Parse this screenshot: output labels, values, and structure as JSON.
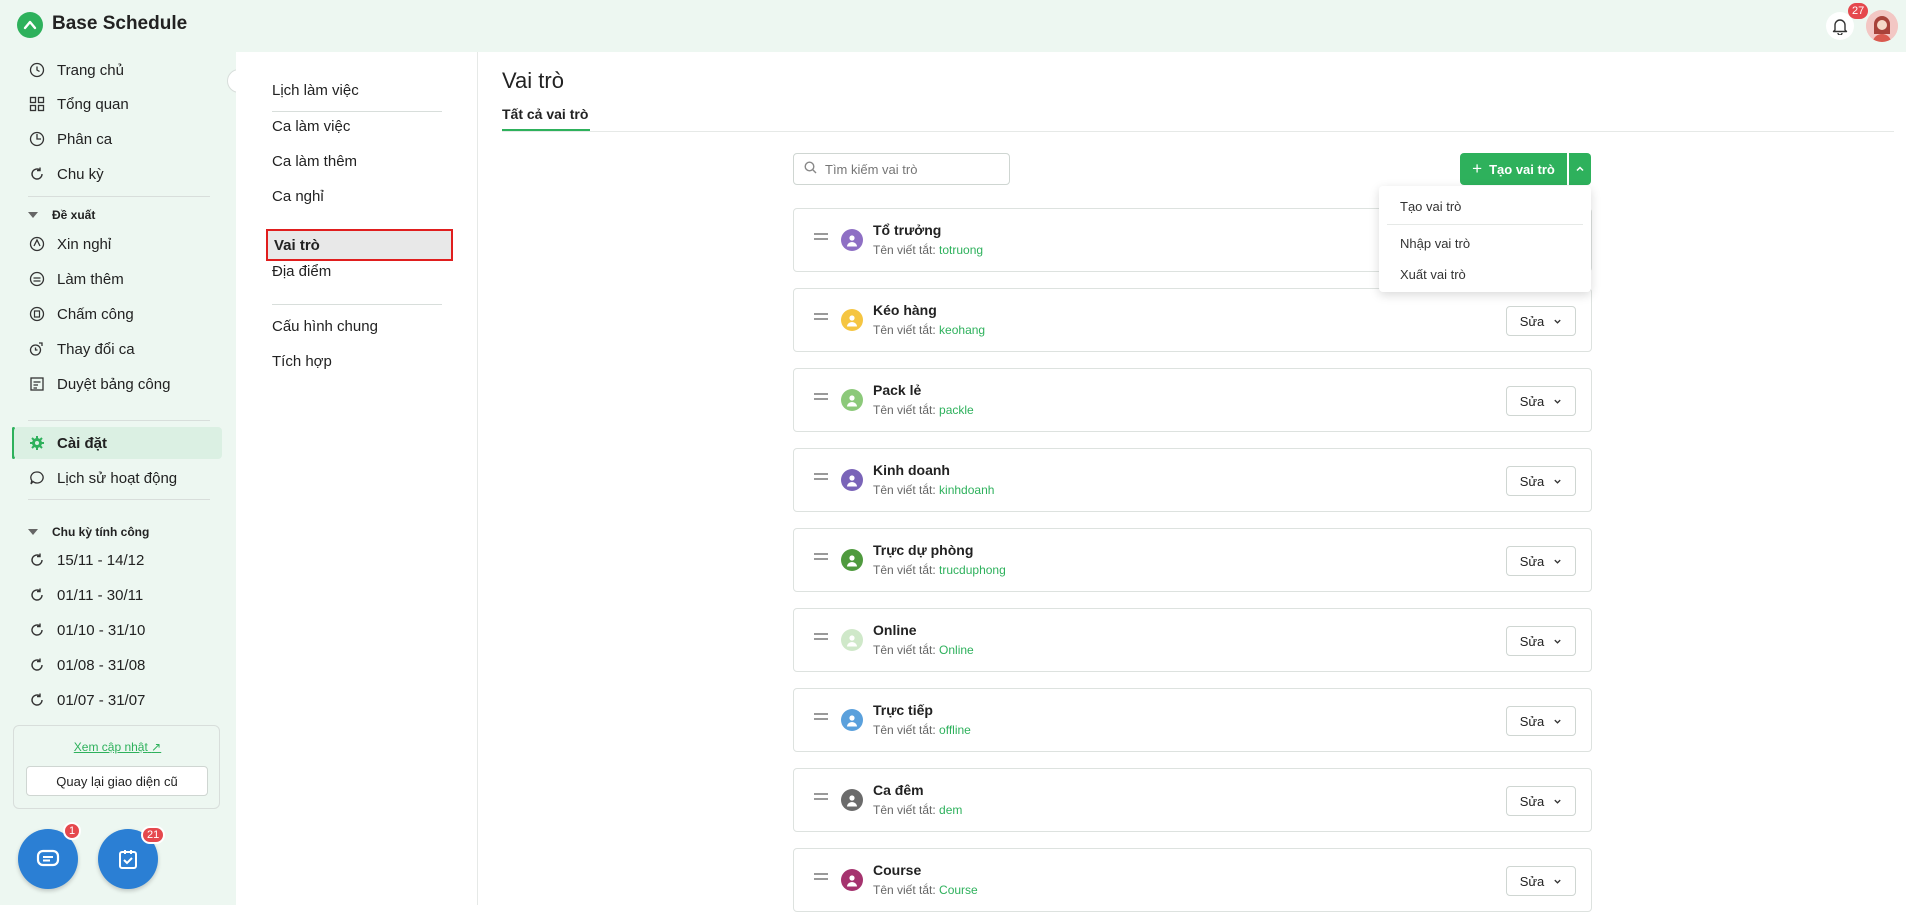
{
  "app": {
    "title": "Base Schedule",
    "notification_count": "27"
  },
  "sidebar": {
    "items": [
      {
        "label": "Trang chủ",
        "icon": "clock-icon"
      },
      {
        "label": "Tổng quan",
        "icon": "grid-icon"
      },
      {
        "label": "Phân ca",
        "icon": "shift-icon"
      },
      {
        "label": "Chu kỳ",
        "icon": "cycle-icon"
      }
    ],
    "proposal_group": "Đề xuất",
    "proposal_items": [
      {
        "label": "Xin nghỉ",
        "icon": "leave-icon"
      },
      {
        "label": "Làm thêm",
        "icon": "overtime-icon"
      },
      {
        "label": "Chấm công",
        "icon": "timesheet-icon"
      },
      {
        "label": "Thay đổi ca",
        "icon": "swap-icon"
      },
      {
        "label": "Duyệt bảng công",
        "icon": "approve-icon"
      }
    ],
    "settings_label": "Cài đặt",
    "history_label": "Lịch sử hoạt động",
    "payroll_group": "Chu kỳ tính công",
    "payroll_periods": [
      "15/11 - 14/12",
      "01/11 - 30/11",
      "01/10 - 31/10",
      "01/08 - 31/08",
      "01/07 - 31/07"
    ],
    "update_link": "Xem cập nhật",
    "old_ui_button": "Quay lại giao diện cũ",
    "chat_badge": "1",
    "task_badge": "21"
  },
  "subnav": {
    "items": [
      "Lịch làm việc",
      "Ca làm việc",
      "Ca làm thêm",
      "Ca nghỉ",
      "Vai trò",
      "Địa điểm",
      "Cấu hình chung",
      "Tích hợp"
    ],
    "active": "Vai trò"
  },
  "main": {
    "title": "Vai trò",
    "tab": "Tất cả vai trò",
    "search_placeholder": "Tìm kiếm vai trò",
    "create_button": "Tạo vai trò",
    "dropdown": [
      "Tạo vai trò",
      "Nhập vai trò",
      "Xuất vai trò"
    ],
    "abbr_label": "Tên viết tắt:",
    "edit_label": "Sửa",
    "roles": [
      {
        "name": "Tổ trưởng",
        "abbr": "totruong",
        "color": "#8e6fc4"
      },
      {
        "name": "Kéo hàng",
        "abbr": "keohang",
        "color": "#f5c542"
      },
      {
        "name": "Pack lẻ",
        "abbr": "packle",
        "color": "#8cc97a"
      },
      {
        "name": "Kinh doanh",
        "abbr": "kinhdoanh",
        "color": "#7a64b8"
      },
      {
        "name": "Trực dự phòng",
        "abbr": "trucduphong",
        "color": "#4f9a3e"
      },
      {
        "name": "Online",
        "abbr": "Online",
        "color": "#cfe8c9"
      },
      {
        "name": "Trực tiếp",
        "abbr": "offline",
        "color": "#5aa0dc"
      },
      {
        "name": "Ca đêm",
        "abbr": "dem",
        "color": "#6b6b6b"
      },
      {
        "name": "Course",
        "abbr": "Course",
        "color": "#a5336e"
      }
    ]
  }
}
